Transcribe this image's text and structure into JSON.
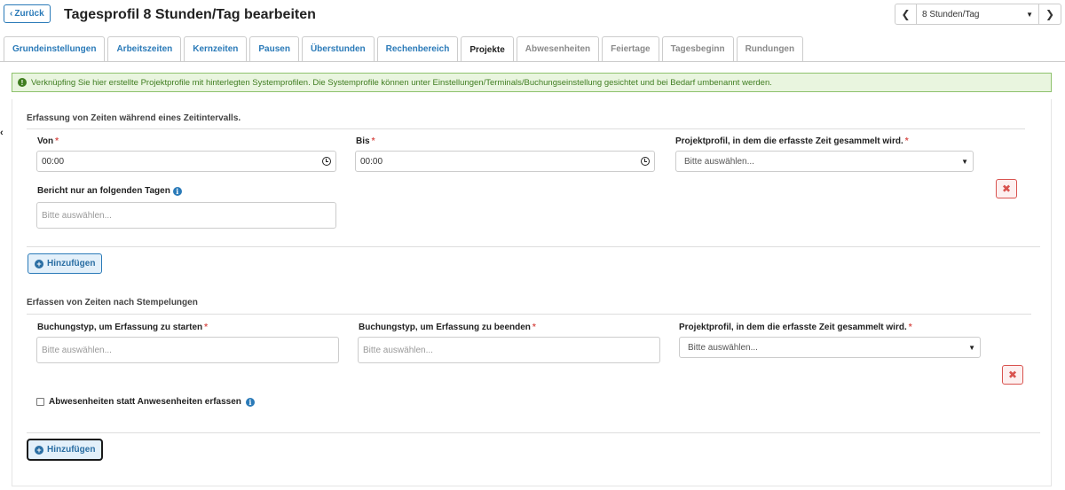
{
  "header": {
    "back_label": "Zurück",
    "title": "Tagesprofil 8 Stunden/Tag bearbeiten",
    "profile_select_value": "8 Stunden/Tag"
  },
  "tabs": [
    {
      "label": "Grundeinstellungen",
      "state": "normal"
    },
    {
      "label": "Arbeitszeiten",
      "state": "normal"
    },
    {
      "label": "Kernzeiten",
      "state": "normal"
    },
    {
      "label": "Pausen",
      "state": "normal"
    },
    {
      "label": "Überstunden",
      "state": "normal"
    },
    {
      "label": "Rechenbereich",
      "state": "normal"
    },
    {
      "label": "Projekte",
      "state": "active"
    },
    {
      "label": "Abwesenheiten",
      "state": "disabled"
    },
    {
      "label": "Feiertage",
      "state": "disabled"
    },
    {
      "label": "Tagesbeginn",
      "state": "disabled"
    },
    {
      "label": "Rundungen",
      "state": "disabled"
    }
  ],
  "alert": {
    "text": "Verknüpfing Sie hier erstellte Projektprofile mit hinterlegten Systemprofilen. Die Systemprofile können unter Einstellungen/Terminals/Buchungseinstellung gesichtet und bei Bedarf umbenannt werden.",
    "color": "#3f7d20"
  },
  "section_interval": {
    "title": "Erfassung von Zeiten während eines Zeitintervalls.",
    "von_label": "Von",
    "von_value": "00:00",
    "bis_label": "Bis",
    "bis_value": "00:00",
    "profile_label": "Projektprofil, in dem die erfasste Zeit gesammelt wird.",
    "profile_placeholder": "Bitte auswählen...",
    "days_label": "Bericht nur an folgenden Tagen",
    "days_placeholder": "Bitte auswählen...",
    "add_label": "Hinzufügen"
  },
  "section_stamps": {
    "title": "Erfassen von Zeiten nach Stempelungen",
    "start_label": "Buchungstyp, um Erfassung zu starten",
    "start_placeholder": "Bitte auswählen...",
    "end_label": "Buchungstyp, um Erfassung zu beenden",
    "end_placeholder": "Bitte auswählen...",
    "profile_label": "Projektprofil, in dem die erfasste Zeit gesammelt wird.",
    "profile_placeholder": "Bitte auswählen...",
    "absence_label": "Abwesenheiten statt Anwesenheiten erfassen",
    "add_label": "Hinzufügen"
  },
  "required_mark": "*",
  "icons": {
    "back": "chevron-left-icon",
    "prev": "chevron-left-icon",
    "next": "chevron-right-icon",
    "caret": "caret-down-icon",
    "clock": "clock-icon",
    "info": "info-icon",
    "remove": "x-icon",
    "add": "plus-circle-icon"
  }
}
